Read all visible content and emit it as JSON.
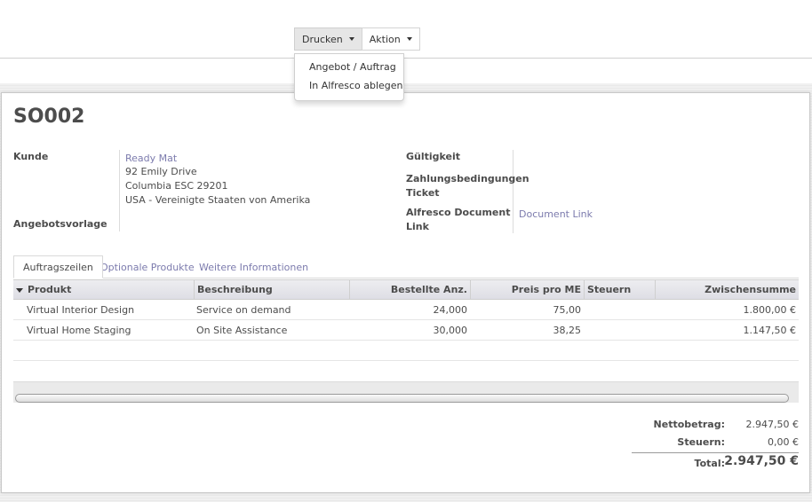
{
  "toolbar": {
    "print_label": "Drucken",
    "action_label": "Aktion",
    "print_menu": [
      "Angebot / Auftrag",
      "In Alfresco ablegen"
    ]
  },
  "form": {
    "title": "SO002",
    "customer_label": "Kunde",
    "customer": {
      "name": "Ready Mat",
      "street": "92 Emily Drive",
      "city": "Columbia ESC 29201",
      "country": "USA - Vereinigte Staaten von Amerika"
    },
    "template_label": "Angebotsvorlage",
    "validity_label": "Gültigkeit",
    "payment_terms_label_1": "Zahlungsbedingungen",
    "payment_terms_label_2": "Ticket",
    "alfresco_label_1": "Alfresco Document",
    "alfresco_label_2": "Link",
    "alfresco_link": "Document Link"
  },
  "tabs": [
    "Auftragszeilen",
    "Optionale Produkte",
    "Weitere Informationen"
  ],
  "table": {
    "columns": [
      "Produkt",
      "Beschreibung",
      "Bestellte Anz.",
      "Preis pro ME",
      "Steuern",
      "Zwischensumme"
    ],
    "rows": [
      {
        "product": "Virtual Interior Design",
        "description": "Service on demand",
        "qty": "24,000",
        "price": "75,00",
        "taxes": "",
        "subtotal": "1.800,00 €"
      },
      {
        "product": "Virtual Home Staging",
        "description": "On Site Assistance",
        "qty": "30,000",
        "price": "38,25",
        "taxes": "",
        "subtotal": "1.147,50 €"
      }
    ]
  },
  "totals": {
    "net_label": "Nettobetrag:",
    "net_value": "2.947,50 €",
    "tax_label": "Steuern:",
    "tax_value": "0,00 €",
    "total_label": "Total:",
    "total_value": "2.947,50 €"
  },
  "colors": {
    "link": "#7c7bad",
    "text": "#4c4c4c"
  }
}
